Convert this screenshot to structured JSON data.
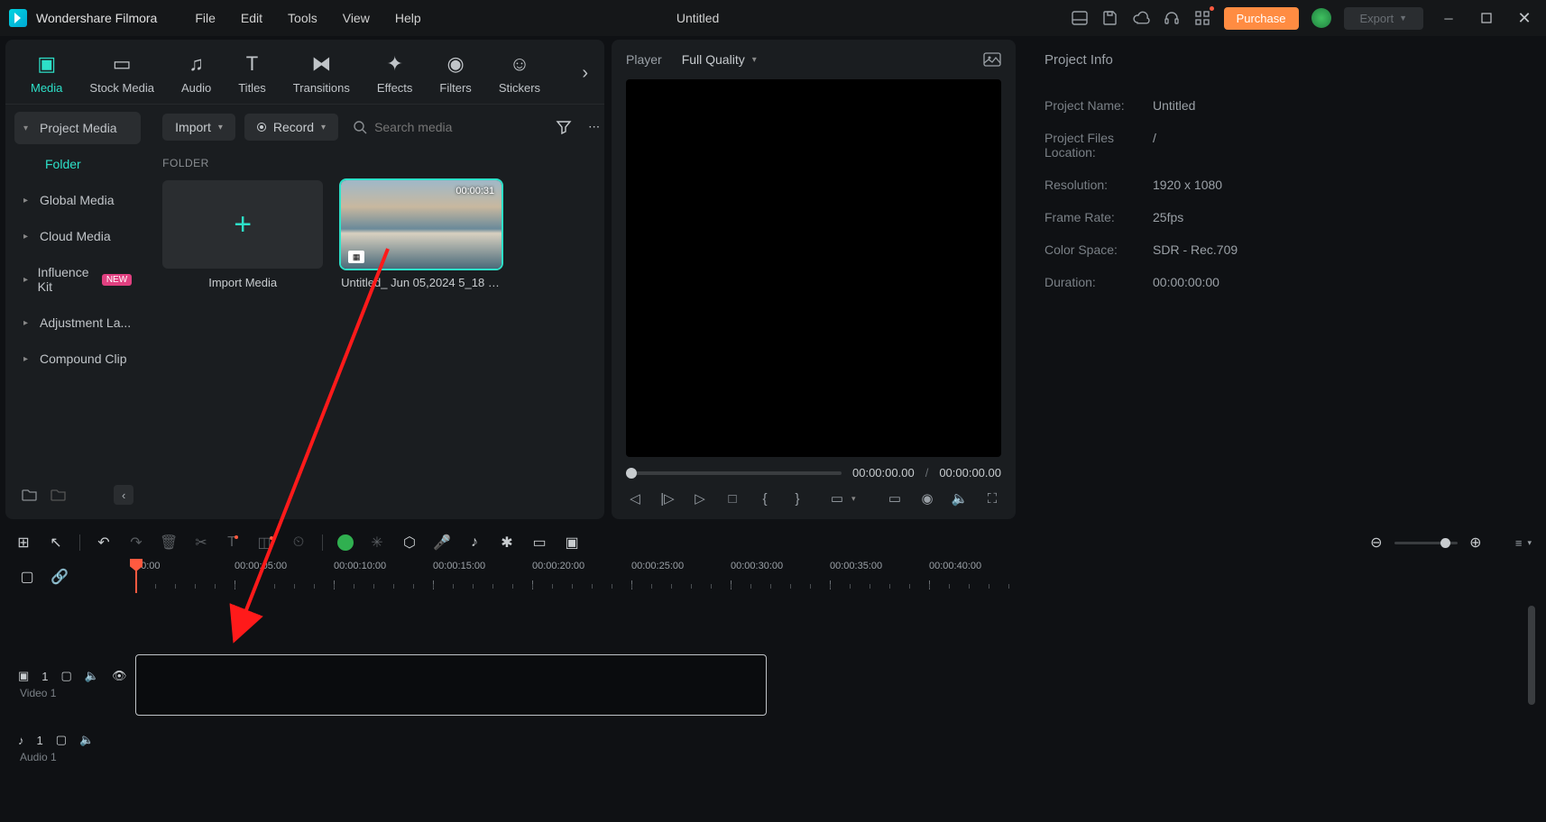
{
  "app": {
    "name": "Wondershare Filmora",
    "doc_title": "Untitled"
  },
  "menu": {
    "file": "File",
    "edit": "Edit",
    "tools": "Tools",
    "view": "View",
    "help": "Help"
  },
  "titlebar": {
    "purchase": "Purchase",
    "export": "Export"
  },
  "lib_tabs": {
    "media": "Media",
    "stock": "Stock Media",
    "audio": "Audio",
    "titles": "Titles",
    "transitions": "Transitions",
    "effects": "Effects",
    "filters": "Filters",
    "stickers": "Stickers"
  },
  "sidebar": {
    "project_media": "Project Media",
    "folder": "Folder",
    "global_media": "Global Media",
    "cloud_media": "Cloud Media",
    "influence_kit": "Influence Kit",
    "influence_badge": "NEW",
    "adjustment": "Adjustment La...",
    "compound": "Compound Clip"
  },
  "toolbar": {
    "import": "Import",
    "record": "Record",
    "search_placeholder": "Search media"
  },
  "folder_label": "FOLDER",
  "media": {
    "import_card": "Import Media",
    "clip1_label": "Untitled_ Jun 05,2024 5_18 P...",
    "clip1_duration": "00:00:31"
  },
  "player": {
    "label": "Player",
    "quality": "Full Quality",
    "time_current": "00:00:00.00",
    "time_total": "00:00:00.00",
    "time_sep": "/"
  },
  "info": {
    "title": "Project Info",
    "k_name": "Project Name:",
    "v_name": "Untitled",
    "k_loc": "Project Files Location:",
    "v_loc": "/",
    "k_res": "Resolution:",
    "v_res": "1920 x 1080",
    "k_fps": "Frame Rate:",
    "v_fps": "25fps",
    "k_cs": "Color Space:",
    "v_cs": "SDR - Rec.709",
    "k_dur": "Duration:",
    "v_dur": "00:00:00:00"
  },
  "timeline": {
    "ruler": [
      "00:00",
      "00:00:05:00",
      "00:00:10:00",
      "00:00:15:00",
      "00:00:20:00",
      "00:00:25:00",
      "00:00:30:00",
      "00:00:35:00",
      "00:00:40:00"
    ],
    "video_track": "Video 1",
    "audio_track": "Audio 1",
    "track_num": "1"
  }
}
